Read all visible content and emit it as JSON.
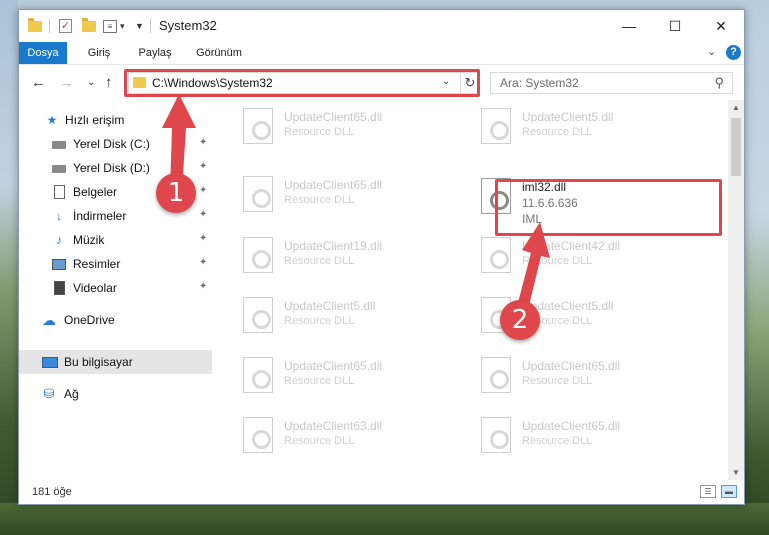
{
  "window": {
    "title": "System32",
    "minimize": "—",
    "maximize": "☐",
    "close": "✕"
  },
  "ribbon": {
    "tabs": [
      "Dosya",
      "Giriş",
      "Paylaş",
      "Görünüm"
    ],
    "expand": "⌄",
    "help": "?"
  },
  "nav": {
    "back": "←",
    "forward": "→",
    "recent": "⌄",
    "up": "↑"
  },
  "address": {
    "path": "C:\\Windows\\System32",
    "dropdown": "⌄",
    "refresh": "↻"
  },
  "search": {
    "placeholder": "Ara: System32",
    "icon": "search-icon"
  },
  "sidebar": {
    "items": [
      {
        "label": "Hızlı erişim",
        "icon": "star-icon"
      },
      {
        "label": "Yerel Disk (C:)",
        "icon": "drive-icon"
      },
      {
        "label": "Yerel Disk (D:)",
        "icon": "drive-icon"
      },
      {
        "label": "Belgeler",
        "icon": "document-icon"
      },
      {
        "label": "İndirmeler",
        "icon": "download-icon"
      },
      {
        "label": "Müzik",
        "icon": "music-icon"
      },
      {
        "label": "Resimler",
        "icon": "pictures-icon"
      },
      {
        "label": "Videolar",
        "icon": "videos-icon"
      },
      {
        "label": "OneDrive",
        "icon": "cloud-icon"
      },
      {
        "label": "Bu bilgisayar",
        "icon": "computer-icon",
        "selected": true
      },
      {
        "label": "Ağ",
        "icon": "network-icon"
      }
    ],
    "pin_glyph": "📌"
  },
  "files": {
    "left": [
      {
        "name": "UpdateClient65.dll",
        "desc": "Resource DLL"
      },
      {
        "name": "UpdateClient65.dll",
        "desc": "Resource DLL"
      },
      {
        "name": "UpdateClient19.dll",
        "desc": "Resource DLL"
      },
      {
        "name": "UpdateClient5.dll",
        "desc": "Resource DLL"
      },
      {
        "name": "UpdateClient65.dll",
        "desc": "Resource DLL"
      },
      {
        "name": "UpdateClient63.dll",
        "desc": "Resource DLL"
      }
    ],
    "right": [
      {
        "name": "UpdateClient5.dll",
        "desc": "Resource DLL"
      },
      {
        "name": "UpdateClient42.dll",
        "desc": "Resource DLL"
      },
      {
        "name": "UpdateClient5.dll",
        "desc": "Resource DLL"
      },
      {
        "name": "UpdateClient65.dll",
        "desc": "Resource DLL"
      },
      {
        "name": "UpdateClient65.dll",
        "desc": "Resource DLL"
      }
    ],
    "highlighted": {
      "name": "iml32.dll",
      "version": "11.6.6.636",
      "desc": "IML"
    }
  },
  "status": {
    "count": "181 öğe"
  },
  "annotations": {
    "badge1": "1",
    "badge2": "2",
    "color": "#e0474c"
  }
}
